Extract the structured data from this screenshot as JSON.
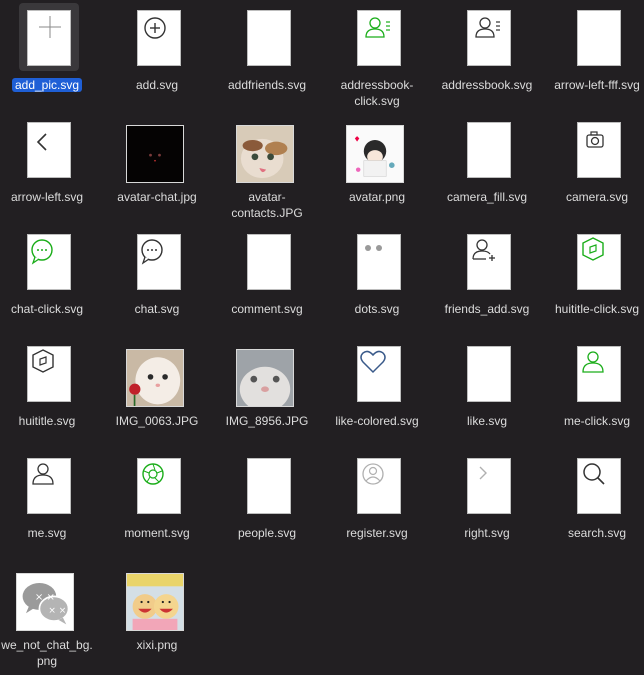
{
  "files": [
    {
      "name": "add_pic.svg",
      "selected": true,
      "icon": "plus-icon",
      "kind": "svg"
    },
    {
      "name": "add.svg",
      "icon": "plus-circle-icon",
      "kind": "svg"
    },
    {
      "name": "addfriends.svg",
      "icon": "blank-icon",
      "kind": "svg"
    },
    {
      "name": "addressbook-\nclick.svg",
      "icon": "address-book-green-icon",
      "kind": "svg"
    },
    {
      "name": "addressbook.svg",
      "icon": "address-book-icon",
      "kind": "svg"
    },
    {
      "name": "arrow-left-fff.svg",
      "icon": "blank-icon",
      "kind": "svg"
    },
    {
      "name": "arrow-left.svg",
      "icon": "chevron-left-icon",
      "kind": "svg"
    },
    {
      "name": "avatar-chat.jpg",
      "icon": "black-cat-photo",
      "kind": "photo"
    },
    {
      "name": "avatar-\ncontacts.JPG",
      "icon": "cat-photo",
      "kind": "photo"
    },
    {
      "name": "avatar.png",
      "icon": "cartoon-avatar-photo",
      "kind": "photo"
    },
    {
      "name": "camera_fill.svg",
      "icon": "blank-icon",
      "kind": "svg"
    },
    {
      "name": "camera.svg",
      "icon": "camera-icon",
      "kind": "svg"
    },
    {
      "name": "chat-click.svg",
      "icon": "chat-bubble-green-icon",
      "kind": "svg"
    },
    {
      "name": "chat.svg",
      "icon": "chat-bubble-icon",
      "kind": "svg"
    },
    {
      "name": "comment.svg",
      "icon": "blank-icon",
      "kind": "svg"
    },
    {
      "name": "dots.svg",
      "icon": "dots-icon",
      "kind": "svg"
    },
    {
      "name": "friends_add.svg",
      "icon": "user-add-icon",
      "kind": "svg"
    },
    {
      "name": "huititle-click.svg",
      "icon": "compass-hexagon-green-icon",
      "kind": "svg"
    },
    {
      "name": "huititle.svg",
      "icon": "compass-hexagon-icon",
      "kind": "svg"
    },
    {
      "name": "IMG_0063.JPG",
      "icon": "white-cat-photo",
      "kind": "photo"
    },
    {
      "name": "IMG_8956.JPG",
      "icon": "cat-closeup-photo",
      "kind": "photo"
    },
    {
      "name": "like-colored.svg",
      "icon": "heart-icon",
      "kind": "svg"
    },
    {
      "name": "like.svg",
      "icon": "blank-icon",
      "kind": "svg"
    },
    {
      "name": "me-click.svg",
      "icon": "user-green-icon",
      "kind": "svg"
    },
    {
      "name": "me.svg",
      "icon": "user-icon",
      "kind": "svg"
    },
    {
      "name": "moment.svg",
      "icon": "aperture-green-icon",
      "kind": "svg"
    },
    {
      "name": "people.svg",
      "icon": "blank-icon",
      "kind": "svg"
    },
    {
      "name": "register.svg",
      "icon": "user-circle-icon",
      "kind": "svg"
    },
    {
      "name": "right.svg",
      "icon": "chevron-right-icon",
      "kind": "svg"
    },
    {
      "name": "search.svg",
      "icon": "search-icon",
      "kind": "svg"
    },
    {
      "name": "we_not_chat_bg.\npng",
      "icon": "chat-bubbles-bg-photo",
      "kind": "photo"
    },
    {
      "name": "xixi.png",
      "icon": "cartoon-kids-photo",
      "kind": "photo"
    }
  ],
  "colors": {
    "green": "#1aad19",
    "gray": "#8a8a8a",
    "dark": "#333333",
    "selection": "#1f5fd6"
  }
}
